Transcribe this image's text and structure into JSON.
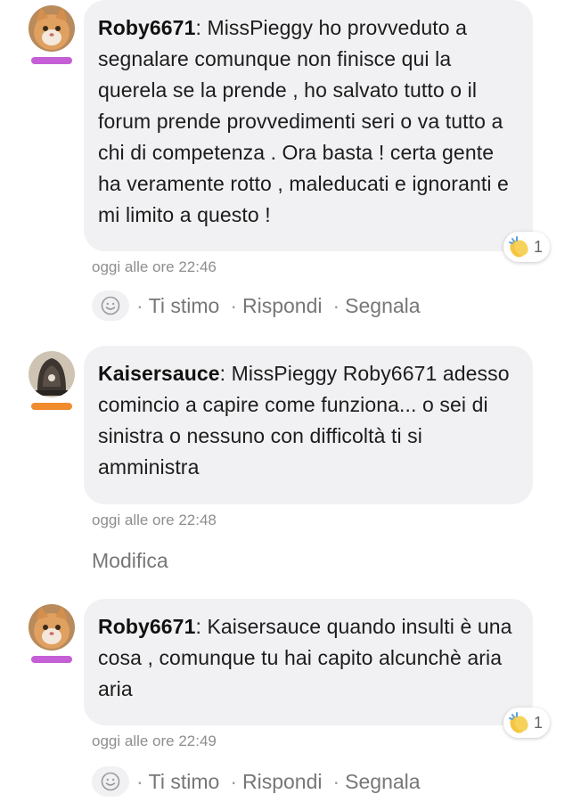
{
  "comments": [
    {
      "author": "Roby6671",
      "text": ": MissPieggy ho provveduto a segnalare comunque non finisce qui la querela se la prende , ho salvato tutto o il forum prende provvedimenti seri o va tutto a chi di competenza . Ora basta ! certa gente ha veramente rotto , maleducati e ignoranti e mi limito a questo !",
      "timestamp": "oggi alle ore 22:46",
      "reaction": {
        "icon": "clapping-hands-icon",
        "count": "1"
      },
      "level_color": "#c45fd6",
      "actions": {
        "like": "Ti stimo",
        "reply": "Rispondi",
        "report": "Segnala"
      }
    },
    {
      "author": "Kaisersauce",
      "text": ": MissPieggy Roby6671 adesso comincio a capire come funziona... o sei di sinistra o nessuno con difficoltà ti si amministra",
      "timestamp": "oggi alle ore 22:48",
      "level_color": "#f08c2e",
      "edit_label": "Modifica"
    },
    {
      "author": "Roby6671",
      "text": ": Kaisersauce quando insulti è una cosa , comunque tu hai capito alcunchè aria aria",
      "timestamp": "oggi alle ore 22:49",
      "reaction": {
        "icon": "clapping-hands-icon",
        "count": "1"
      },
      "level_color": "#c45fd6",
      "actions": {
        "like": "Ti stimo",
        "reply": "Rispondi",
        "report": "Segnala"
      }
    }
  ],
  "separator": "·"
}
